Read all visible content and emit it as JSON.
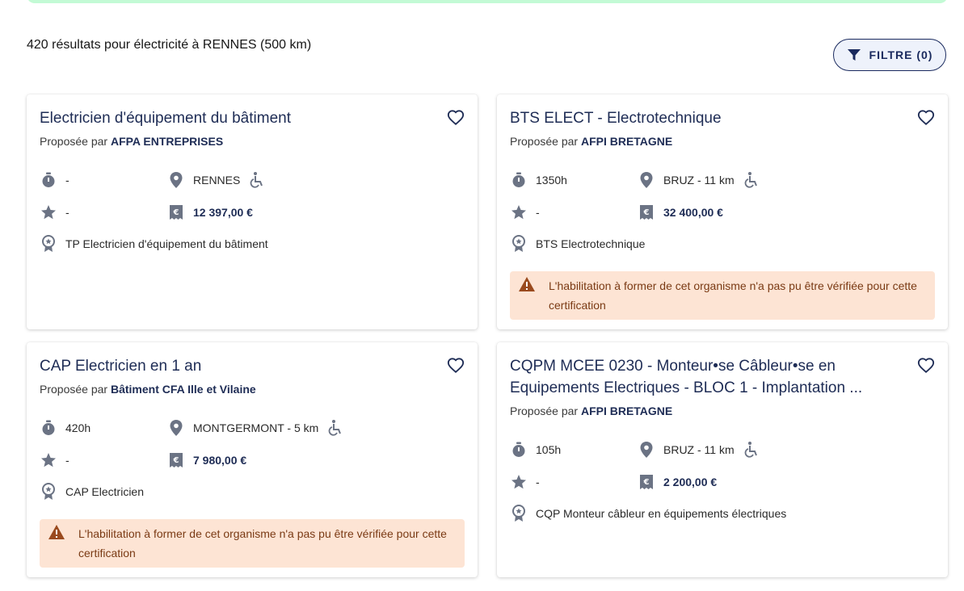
{
  "results": {
    "summary": "420 résultats pour électricité à RENNES (500 km)",
    "filter_label": "FILTRE (0)"
  },
  "cards": [
    {
      "title": "Electricien d'équipement du bâtiment",
      "provider_prefix": "Proposée par",
      "provider": "AFPA ENTREPRISES",
      "duration": "-",
      "location": "RENNES",
      "rating": "-",
      "price": "12 397,00 €",
      "certification": "TP Electricien d'équipement du bâtiment"
    },
    {
      "title": "BTS ELECT - Electrotechnique",
      "provider_prefix": "Proposée par",
      "provider": "AFPI BRETAGNE",
      "duration": "1350h",
      "location": "BRUZ - 11 km",
      "rating": "-",
      "price": "32 400,00 €",
      "certification": "BTS Electrotechnique",
      "warning": "L'habilitation à former de cet organisme n'a pas pu être vérifiée pour cette certification"
    },
    {
      "title": "CAP Electricien en 1 an",
      "provider_prefix": "Proposée par",
      "provider": "Bâtiment CFA Ille et Vilaine",
      "duration": "420h",
      "location": "MONTGERMONT - 5 km",
      "rating": "-",
      "price": "7 980,00 €",
      "certification": "CAP Electricien",
      "warning": "L'habilitation à former de cet organisme n'a pas pu être vérifiée pour cette certification"
    },
    {
      "title": "CQPM MCEE 0230 - Monteur•se Câbleur•se en Equipements Electriques - BLOC 1 - Implantation ...",
      "provider_prefix": "Proposée par",
      "provider": "AFPI BRETAGNE",
      "duration": "105h",
      "location": "BRUZ - 11 km",
      "rating": "-",
      "price": "2 200,00 €",
      "certification": "CQP Monteur câbleur en équipements électriques"
    }
  ],
  "icons": {
    "duration": "stopwatch-icon",
    "location": "map-pin-icon",
    "accessibility": "wheelchair-icon",
    "rating": "star-icon",
    "price": "euro-receipt-icon",
    "certification": "certificate-badge-icon",
    "favorite": "heart-outline-icon",
    "warning": "warning-triangle-icon",
    "filter": "funnel-icon"
  },
  "colors": {
    "primary": "#1e2c55",
    "icon_grey": "#6b7384",
    "warning_bg": "#fde4d4",
    "warning_text": "#7a3a14",
    "banner": "#c3fad5"
  }
}
